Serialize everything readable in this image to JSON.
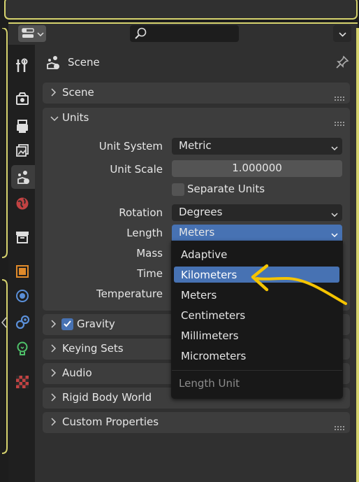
{
  "header": {
    "search_value": "",
    "editor_type_icon": "properties-editor-icon"
  },
  "context": {
    "title": "Scene",
    "pin_icon": "pin-icon"
  },
  "tabs": [
    {
      "name": "tool-tab",
      "icon": "tool-icon"
    },
    {
      "name": "render-tab",
      "icon": "render-icon"
    },
    {
      "name": "output-tab",
      "icon": "output-icon"
    },
    {
      "name": "view-layer-tab",
      "icon": "view-layer-icon"
    },
    {
      "name": "scene-tab",
      "icon": "scene-icon",
      "active": true
    },
    {
      "name": "world-tab",
      "icon": "world-icon"
    },
    {
      "name": "collection-tab",
      "icon": "collection-icon"
    },
    {
      "name": "object-tab",
      "icon": "object-icon"
    },
    {
      "name": "physics-tab",
      "icon": "physics-icon"
    },
    {
      "name": "constraints-tab",
      "icon": "constraints-icon"
    },
    {
      "name": "data-tab",
      "icon": "data-icon"
    },
    {
      "name": "texture-tab",
      "icon": "texture-icon"
    }
  ],
  "panels": {
    "scene": "Scene",
    "units": "Units",
    "gravity": "Gravity",
    "keying_sets": "Keying Sets",
    "audio": "Audio",
    "rigid_body_world": "Rigid Body World",
    "custom_properties": "Custom Properties"
  },
  "units": {
    "unit_system_label": "Unit System",
    "unit_system_value": "Metric",
    "unit_scale_label": "Unit Scale",
    "unit_scale_value": "1.000000",
    "separate_units_label": "Separate Units",
    "separate_units_checked": false,
    "rotation_label": "Rotation",
    "rotation_value": "Degrees",
    "length_label": "Length",
    "length_value": "Meters",
    "mass_label": "Mass",
    "time_label": "Time",
    "temperature_label": "Temperature"
  },
  "gravity_checked": true,
  "length_menu": {
    "items": [
      "Adaptive",
      "Kilometers",
      "Meters",
      "Centimeters",
      "Millimeters",
      "Micrometers"
    ],
    "highlighted": "Kilometers",
    "title": "Length Unit"
  },
  "colors": {
    "accent": "#4772b3",
    "annotation": "#f5c400",
    "border_highlight": "#d6d36e",
    "panel": "#3d3d3d",
    "background": "#303030"
  }
}
